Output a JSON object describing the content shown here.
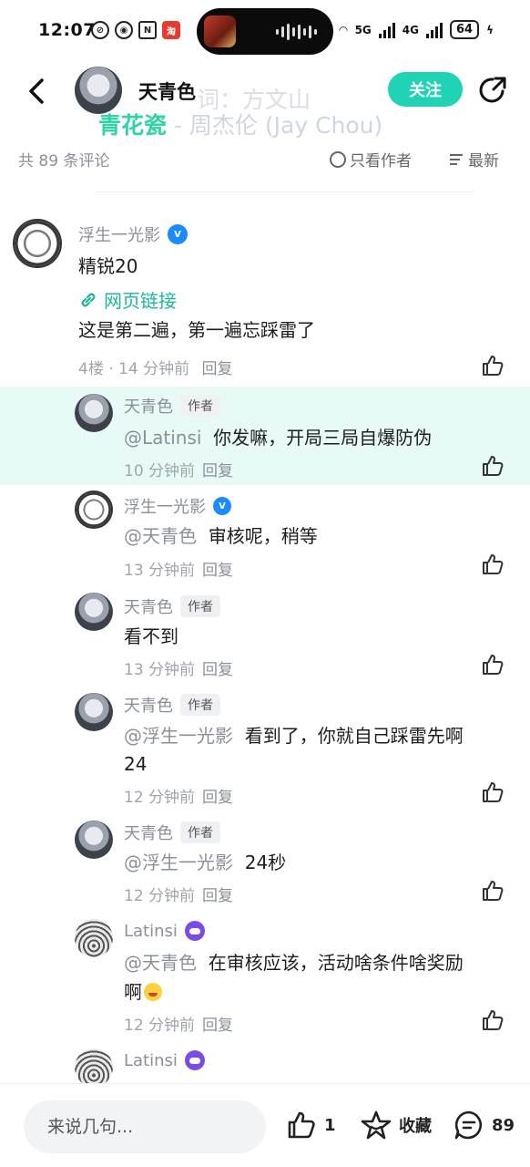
{
  "status": {
    "time": "12:07",
    "net1": "5G",
    "net2": "4G",
    "battery": "64"
  },
  "header": {
    "title": "天青色",
    "follow_label": "关注",
    "lyric_song": "青花瓷",
    "lyric_rest": " - 周杰伦 (Jay Chou)",
    "lyric_line2": "词：方文山"
  },
  "filter": {
    "count": "共 89 条评论",
    "only_author": "只看作者",
    "sort": "最新"
  },
  "main_comment": {
    "author": "浮生一光影",
    "text": "精锐20",
    "link_label": "网页链接",
    "text2": "这是第二遍，第一遍忘踩雷了",
    "floor": "4楼",
    "time": "14 分钟前",
    "reply": "回复"
  },
  "replies": [
    {
      "author": "天青色",
      "badge": "作者",
      "mention": "@Latinsi",
      "text": "你发嘛，开局三局自爆防伪",
      "time": "10 分钟前",
      "reply": "回复"
    },
    {
      "author": "浮生一光影",
      "badge": "",
      "mention": "@天青色",
      "text": "审核呢，稍等",
      "time": "13 分钟前",
      "reply": "回复"
    },
    {
      "author": "天青色",
      "badge": "作者",
      "mention": "",
      "text": "看不到",
      "time": "13 分钟前",
      "reply": "回复"
    },
    {
      "author": "天青色",
      "badge": "作者",
      "mention": "@浮生一光影",
      "text": "看到了，你就自己踩雷先啊",
      "text2": "24",
      "time": "12 分钟前",
      "reply": "回复"
    },
    {
      "author": "天青色",
      "badge": "作者",
      "mention": "@浮生一光影",
      "text": "24秒",
      "time": "12 分钟前",
      "reply": "回复"
    },
    {
      "author": "Latinsi",
      "badge": "",
      "mention": "@天青色",
      "text": "在审核应该，活动啥条件啥奖励",
      "text2": "啊",
      "time": "12 分钟前",
      "reply": "回复"
    },
    {
      "author": "Latinsi",
      "badge": "",
      "mention": "",
      "text": "",
      "time": "",
      "reply": ""
    }
  ],
  "bottom": {
    "placeholder": "来说几句...",
    "likes": "1",
    "collect": "收藏",
    "comments": "89"
  },
  "colors": {
    "accent": "#1fd3b4",
    "link": "#1ab89a",
    "highlight_bg": "#e8faf6",
    "vip_blue": "#1a8cff",
    "game_purple": "#7b4be6"
  }
}
